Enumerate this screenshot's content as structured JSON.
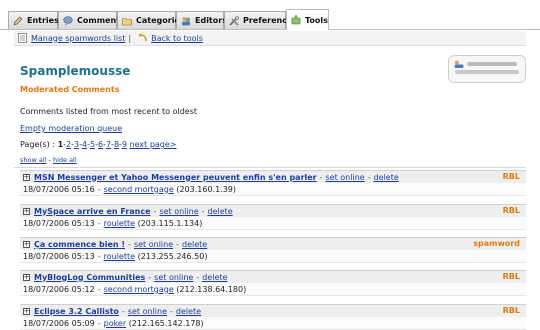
{
  "tabs": [
    {
      "label": "Entries",
      "icon": "pencil-icon"
    },
    {
      "label": "Comments",
      "icon": "comments-icon"
    },
    {
      "label": "Categories",
      "icon": "folder-icon"
    },
    {
      "label": "Editors",
      "icon": "editors-icon"
    },
    {
      "label": "Preferences",
      "icon": "tools-icon"
    },
    {
      "label": "Tools",
      "icon": "puzzle-icon"
    }
  ],
  "toolbar": {
    "manage_label": "Manage spamwords list",
    "separator": "|",
    "back_label": "Back to tools"
  },
  "page": {
    "title": "Spamplemousse",
    "subtitle": "Moderated Comments",
    "description": "Comments listed from most recent to oldest",
    "empty_queue": "Empty moderation queue"
  },
  "pager": {
    "prefix": "Page(s) : ",
    "current": "1",
    "pages": [
      "2",
      "3",
      "4",
      "5",
      "6",
      "7",
      "8",
      "9"
    ],
    "next": "next page>"
  },
  "toggle": {
    "show_all": "show all",
    "dash": " - ",
    "hide_all": "hide all"
  },
  "actions": {
    "set_online": "set online",
    "delete": "delete",
    "dash": "-"
  },
  "comments": [
    {
      "title": "MSN Messenger et Yahoo Messenger peuvent enfin s'en parler",
      "date": "18/07/2006 05:16",
      "author": "second mortgage",
      "ip": "(203.160.1.39)",
      "badge": "RBL"
    },
    {
      "title": "MySpace arrive en France",
      "date": "18/07/2006 05:13",
      "author": "roulette",
      "ip": "(203.115.1.134)",
      "badge": "RBL"
    },
    {
      "title": "Ça commence bien !",
      "date": "18/07/2006 05:13",
      "author": "roulette",
      "ip": "(213.255.246.50)",
      "badge": "spamword"
    },
    {
      "title": "MyBlogLog Communities",
      "date": "18/07/2006 05:12",
      "author": "second mortgage",
      "ip": "(212.138.64.180)",
      "badge": "RBL"
    },
    {
      "title": "Eclipse 3.2 Callisto",
      "date": "18/07/2006 05:09",
      "author": "poker",
      "ip": "(212.165.142.178)",
      "badge": "RBL"
    }
  ],
  "colors": {
    "title": "#1f6f8f",
    "subtitle": "#e07a10",
    "link": "#1d3f9a",
    "badge": "#e07a10"
  }
}
